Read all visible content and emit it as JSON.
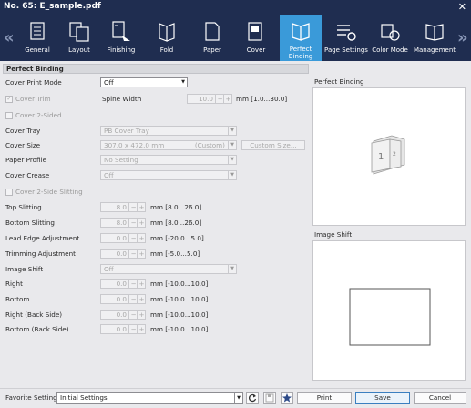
{
  "window": {
    "title": "No. 65: E_sample.pdf",
    "close_label": "✕"
  },
  "ribbon": {
    "prev_label": "«",
    "next_label": "»",
    "tabs": [
      {
        "label": "General",
        "icon": "general-icon"
      },
      {
        "label": "Layout",
        "icon": "layout-icon"
      },
      {
        "label": "Finishing",
        "icon": "finishing-icon"
      },
      {
        "label": "Fold",
        "icon": "fold-icon"
      },
      {
        "label": "Paper",
        "icon": "paper-icon"
      },
      {
        "label": "Cover",
        "icon": "cover-icon"
      },
      {
        "label": "Perfect\nBinding",
        "icon": "perfect-binding-icon",
        "active": true
      },
      {
        "label": "Page Settings",
        "icon": "page-settings-icon"
      },
      {
        "label": "Color Mode",
        "icon": "color-mode-icon"
      },
      {
        "label": "Management",
        "icon": "management-icon"
      }
    ]
  },
  "section_title": "Perfect Binding",
  "form": {
    "cover_print_mode": {
      "label": "Cover Print Mode",
      "value": "Off"
    },
    "cover_trim": {
      "label": "Cover Trim",
      "checked": true
    },
    "spine_width": {
      "label": "Spine Width",
      "value": "10.0",
      "range": "mm [1.0...30.0]"
    },
    "cover_2sided": {
      "label": "Cover 2-Sided"
    },
    "cover_tray": {
      "label": "Cover Tray",
      "value": "PB Cover Tray"
    },
    "cover_size": {
      "label": "Cover Size",
      "value": "307.0 x 472.0 mm",
      "note": "(Custom)",
      "button": "Custom Size..."
    },
    "paper_profile": {
      "label": "Paper Profile",
      "value": "No Setting"
    },
    "cover_crease": {
      "label": "Cover Crease",
      "value": "Off"
    },
    "cover_2side_slitting": {
      "label": "Cover 2-Side Slitting"
    },
    "top_slitting": {
      "label": "Top Slitting",
      "value": "8.0",
      "range": "mm [8.0...26.0]"
    },
    "bottom_slitting": {
      "label": "Bottom Slitting",
      "value": "8.0",
      "range": "mm [8.0...26.0]"
    },
    "lead_edge": {
      "label": "Lead Edge Adjustment",
      "value": "0.0",
      "range": "mm [-20.0...5.0]"
    },
    "trimming": {
      "label": "Trimming Adjustment",
      "value": "0.0",
      "range": "mm [-5.0...5.0]"
    },
    "image_shift": {
      "label": "Image Shift",
      "value": "Off"
    },
    "right": {
      "label": "Right",
      "value": "0.0",
      "range": "mm [-10.0...10.0]"
    },
    "bottom": {
      "label": "Bottom",
      "value": "0.0",
      "range": "mm [-10.0...10.0]"
    },
    "right_back": {
      "label": "Right (Back Side)",
      "value": "0.0",
      "range": "mm [-10.0...10.0]"
    },
    "bottom_back": {
      "label": "Bottom (Back Side)",
      "value": "0.0",
      "range": "mm [-10.0...10.0]"
    },
    "minus": "−",
    "plus": "+"
  },
  "preview": {
    "perfect_binding_title": "Perfect Binding",
    "image_shift_title": "Image Shift",
    "page1": "1",
    "page2": "2"
  },
  "footer": {
    "favorite_label": "Favorite Setting",
    "favorite_value": "Initial Settings",
    "print": "Print",
    "save": "Save",
    "cancel": "Cancel"
  }
}
